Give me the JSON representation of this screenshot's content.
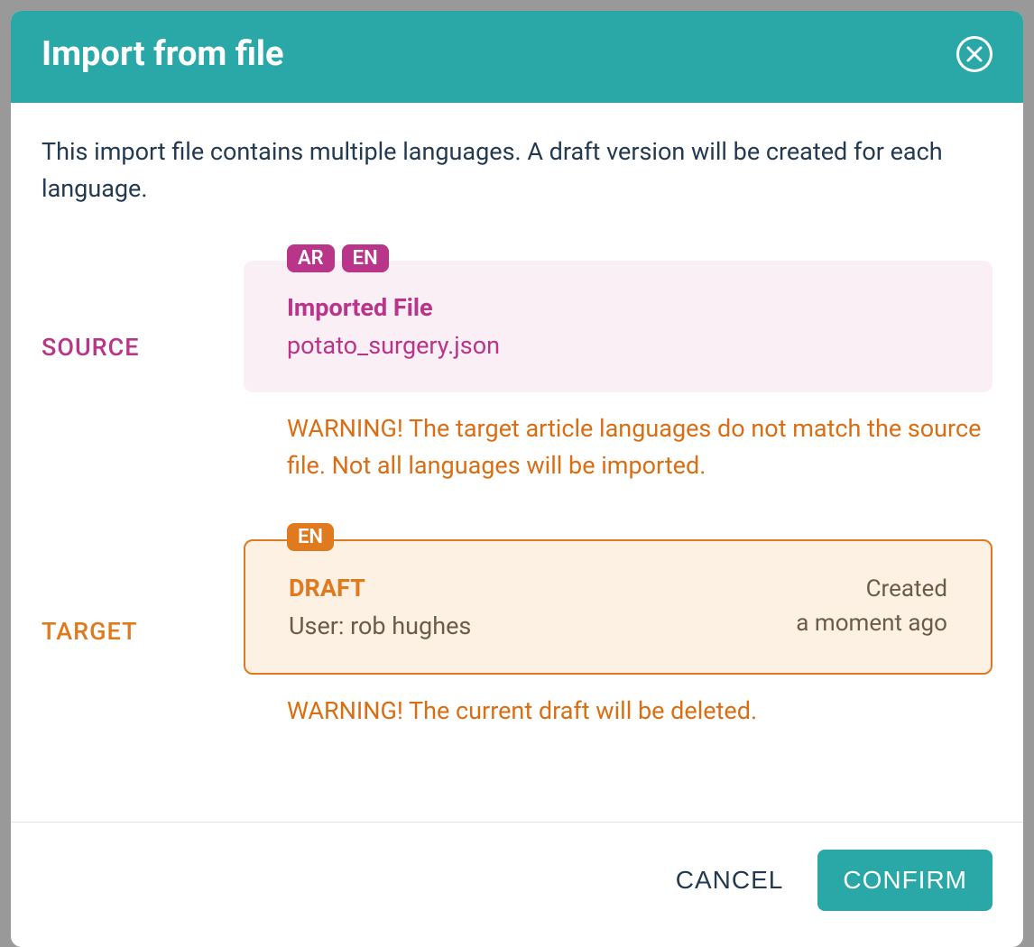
{
  "modal": {
    "title": "Import from file",
    "intro": "This import file contains multiple languages. A draft version will be created for each language."
  },
  "source": {
    "label": "SOURCE",
    "badges": [
      "AR",
      "EN"
    ],
    "heading": "Imported File",
    "filename": "potato_surgery.json",
    "warning": "WARNING! The target article languages do not match the source file. Not all languages will be imported."
  },
  "target": {
    "label": "TARGET",
    "badges": [
      "EN"
    ],
    "heading": "DRAFT",
    "user_line": "User: rob hughes",
    "created_label": "Created",
    "created_time": "a moment ago",
    "warning": "WARNING! The current draft will be deleted."
  },
  "footer": {
    "cancel": "CANCEL",
    "confirm": "CONFIRM"
  }
}
